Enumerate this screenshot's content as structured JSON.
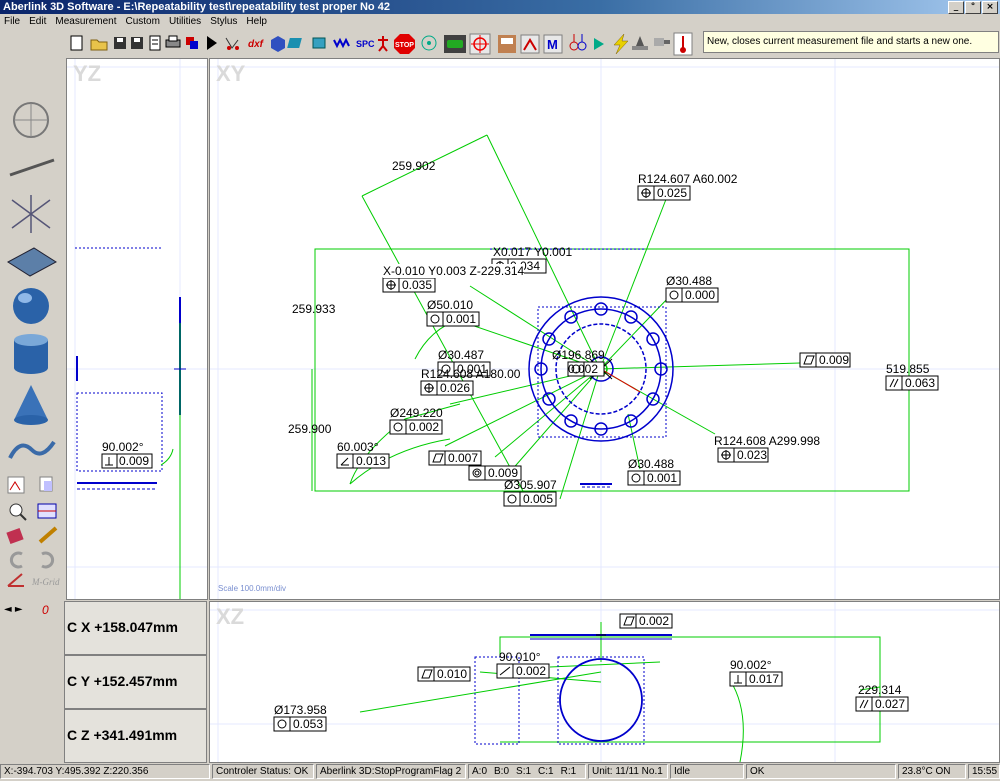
{
  "app": {
    "title": "Aberlink 3D Software - E:\\Repeatability test\\repeatability test proper No 42",
    "window_buttons": {
      "minimize": "_",
      "restore": "°",
      "close": "×"
    }
  },
  "menu": [
    "File",
    "Edit",
    "Measurement",
    "Custom",
    "Utilities",
    "Stylus",
    "Help"
  ],
  "toolbar": {
    "icons": [
      "new-file-icon",
      "open-folder-icon",
      "save-icon",
      "save-as-icon",
      "report-icon",
      "print-icon",
      "import-icon",
      "run-program-icon",
      "feature-scan-icon",
      "dxf-icon",
      "cad-icon",
      "points-icon",
      "probe-icon",
      "wave-icon",
      "spc-icon",
      "teach-icon",
      "stop-icon",
      "rotary-icon",
      "car-icon",
      "datum-crosshair-icon",
      "database-icon",
      "align-icon",
      "macro-icon",
      "stylus-change-icon",
      "temperature-icon",
      "lightning-icon",
      "fixture-icon",
      "probe-head-icon",
      "thermometer-icon"
    ],
    "labels": {
      "dxf": "dxf",
      "spc": "SPC",
      "stop": "STOP",
      "macro": "M"
    },
    "hint": "New, closes current measurement file and starts a new one."
  },
  "left_tools": {
    "mgrid": "M-Grid",
    "zero": "0",
    "arrows": "◄ ►"
  },
  "views": {
    "yz": {
      "label": "YZ"
    },
    "xy": {
      "label": "XY",
      "scale": "Scale 100.0mm/div"
    },
    "xz": {
      "label": "XZ"
    }
  },
  "readouts": {
    "cx": "C X +158.047mm",
    "cy": "C Y +152.457mm",
    "cz": "C Z +341.491mm"
  },
  "annotations_xy": {
    "a1": "259.902",
    "a2": "R124.607 A60.002",
    "a3": "0.025",
    "a4": "X0.017 Y0.001",
    "a5": "0.034",
    "a6": "X-0.010 Y0.003 Z-229.314",
    "a7": "0.035",
    "a8": "Ø30.488",
    "a9": "0.000",
    "a10": "259.933",
    "a11": "Ø50.010",
    "a12": "0.001",
    "a13": "Ø30.487",
    "a14": "0.001",
    "a15": "Ø196.869",
    "a16": "0.002",
    "a17": "0.009",
    "a18": "R124.608 A180.00",
    "a19": "0.026",
    "a20": "519.855",
    "a21": "0.063",
    "a22": "Ø249.220",
    "a23": "0.002",
    "a24": "259.900",
    "a25": "R124.608 A299.998",
    "a26": "0.023",
    "a27": "60.003°",
    "a28": "0.013",
    "a29": "0.007",
    "a30": "Ø30.488",
    "a31": "0.001",
    "a32": "0.009",
    "a33": "Ø305.907",
    "a34": "0.005"
  },
  "annotations_yz": {
    "b1": "90.002°",
    "b2": "0.009"
  },
  "annotations_xz": {
    "c1": "0.002",
    "c2": "90.010°",
    "c3": "0.002",
    "c4": "0.010",
    "c5": "90.002°",
    "c6": "0.017",
    "c7": "229.314",
    "c8": "0.027",
    "c9": "Ø173.958",
    "c10": "0.053"
  },
  "status": {
    "coords": "X:-394.703 Y:495.392 Z:220.356",
    "controller": "Controler Status: OK",
    "program": "Aberlink 3D:StopProgramFlag 2",
    "a": "A:0",
    "b": "B:0",
    "s": "S:1",
    "c": "C:1",
    "r": "R:1",
    "unit": "Unit: 11/11 No.1",
    "idle": "Idle",
    "ok": "OK",
    "temp": "23.8°C ON",
    "time": "15:55"
  },
  "colors": {
    "feature": "#0000cc",
    "construction": "#00cc00",
    "grid": "#e4e8ff",
    "label": "#000000"
  }
}
